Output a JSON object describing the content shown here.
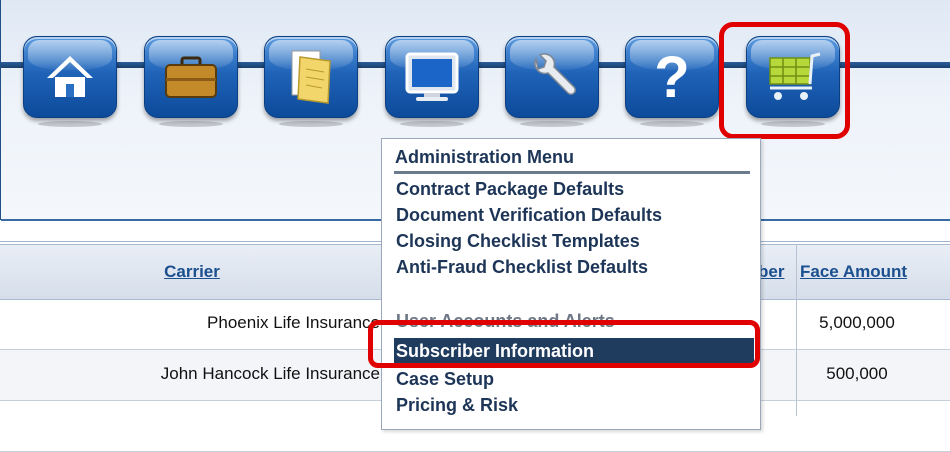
{
  "nav": {
    "buttons": [
      {
        "name": "home",
        "icon": "home-icon"
      },
      {
        "name": "briefcase",
        "icon": "briefcase-icon"
      },
      {
        "name": "documents",
        "icon": "documents-icon"
      },
      {
        "name": "monitor",
        "icon": "monitor-icon"
      },
      {
        "name": "tools",
        "icon": "wrench-icon"
      },
      {
        "name": "help",
        "icon": "question-icon"
      },
      {
        "name": "cart",
        "icon": "shopping-cart-icon"
      }
    ],
    "highlight_color": "#e00000"
  },
  "menu": {
    "title": "Administration Menu",
    "items": [
      "Contract Package Defaults",
      "Document Verification Defaults",
      "Closing Checklist Templates",
      "Anti-Fraud Checklist Defaults",
      "User Accounts and Alerts",
      "Subscriber Information",
      "Case Setup",
      "Pricing & Risk"
    ],
    "selected": "Subscriber Information"
  },
  "table": {
    "headers": {
      "carrier": "Carrier",
      "number": "ber",
      "face_amount": "Face Amount"
    },
    "rows": [
      {
        "carrier": "Phoenix Life Insurance",
        "face_amount": "5,000,000"
      },
      {
        "carrier": "John Hancock Life Insurance",
        "face_amount": "500,000"
      }
    ]
  },
  "colors": {
    "header_link": "#1b4f8f",
    "menu_selected_bg": "#1f3b5e",
    "nav_button": "#1f63b8"
  }
}
